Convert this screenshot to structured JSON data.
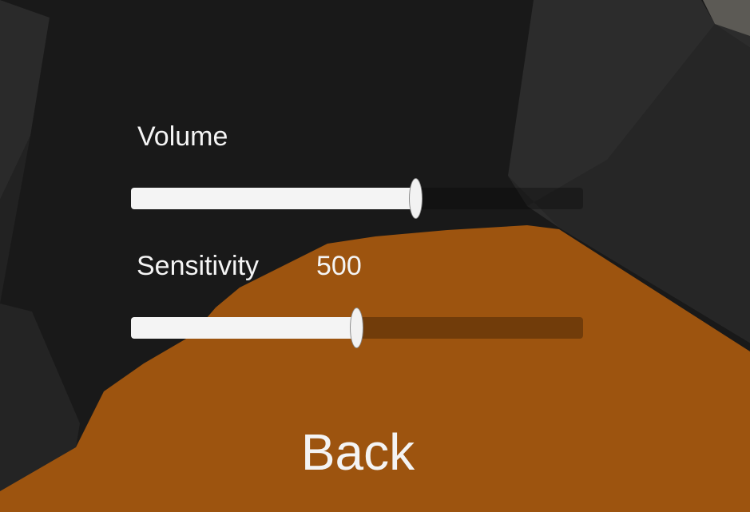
{
  "volume": {
    "label": "Volume",
    "level": 0.63
  },
  "sensitivity": {
    "label": "Sensitivity",
    "value": "500",
    "level": 0.5
  },
  "back_label": "Back",
  "colors": {
    "background": "#191919",
    "ground": "#9d540f",
    "text": "#f4f4f4",
    "slider_fill": "#f4f4f4"
  }
}
